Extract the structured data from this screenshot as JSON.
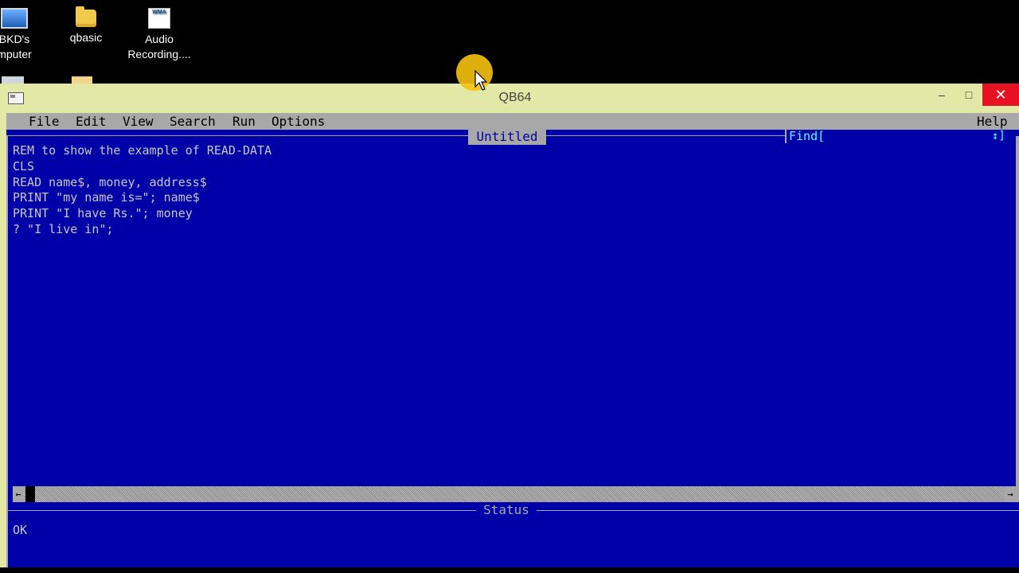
{
  "desktop": {
    "icons": [
      {
        "label_line1": "BKD's",
        "label_line2": "mputer"
      },
      {
        "label_line1": "qbasic",
        "label_line2": ""
      },
      {
        "label_line1": "Audio",
        "label_line2": "Recording...."
      }
    ],
    "wma_badge": "WMA"
  },
  "window": {
    "title": "QB64",
    "controls": {
      "minimize": "–",
      "maximize": "□",
      "close": "✕"
    }
  },
  "menu": {
    "items": [
      "File",
      "Edit",
      "View",
      "Search",
      "Run",
      "Options"
    ],
    "help": "Help"
  },
  "editor": {
    "title": "Untitled",
    "find_label": "Find[",
    "find_arrows": "↕]",
    "lines": [
      "REM to show the example of READ-DATA",
      "CLS",
      "READ name$, money, address$",
      "PRINT \"my name is=\"; name$",
      "PRINT \"I have Rs.\"; money",
      "? \"I live in\";"
    ]
  },
  "scrollbar": {
    "left_arrow": "←",
    "right_arrow": "→"
  },
  "status": {
    "title": "Status",
    "text": "OK"
  }
}
